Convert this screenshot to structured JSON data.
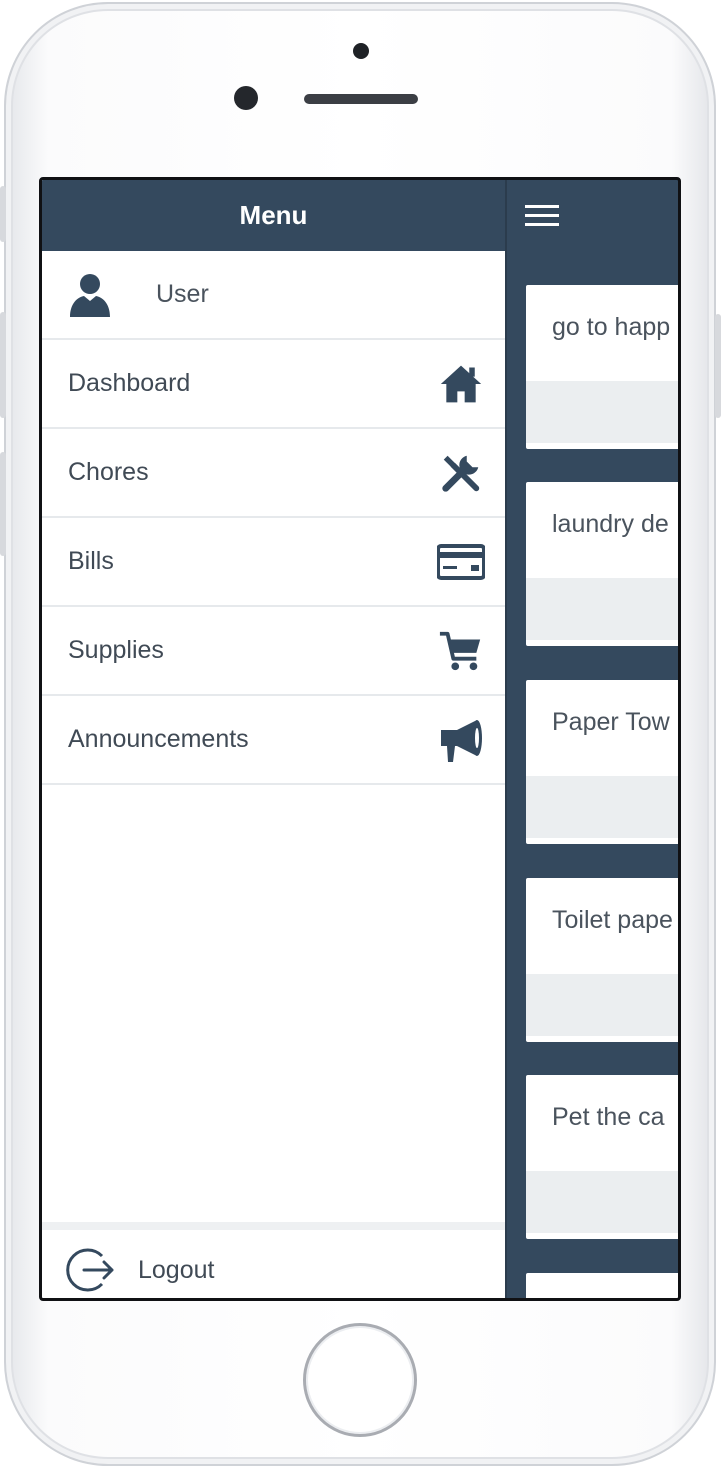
{
  "menu": {
    "title": "Menu",
    "user": {
      "label": "User",
      "icon": "user-icon"
    },
    "items": [
      {
        "label": "Dashboard",
        "icon": "home-icon"
      },
      {
        "label": "Chores",
        "icon": "tools-icon"
      },
      {
        "label": "Bills",
        "icon": "credit-card-icon"
      },
      {
        "label": "Supplies",
        "icon": "shopping-cart-icon"
      },
      {
        "label": "Announcements",
        "icon": "megaphone-icon"
      }
    ],
    "logout": {
      "label": "Logout",
      "icon": "logout-icon"
    }
  },
  "content": {
    "menu_toggle_icon": "hamburger-icon",
    "cards": [
      {
        "text": "go to happ"
      },
      {
        "text": "laundry de"
      },
      {
        "text": "Paper Tow"
      },
      {
        "text": "Toilet pape"
      },
      {
        "text": "Pet the ca"
      },
      {
        "text": ""
      }
    ]
  },
  "colors": {
    "header": "#34495e",
    "menu_bg": "#ffffff",
    "menu_text": "#404a55",
    "icon": "#34495e",
    "card_footer": "#ebeef0"
  }
}
